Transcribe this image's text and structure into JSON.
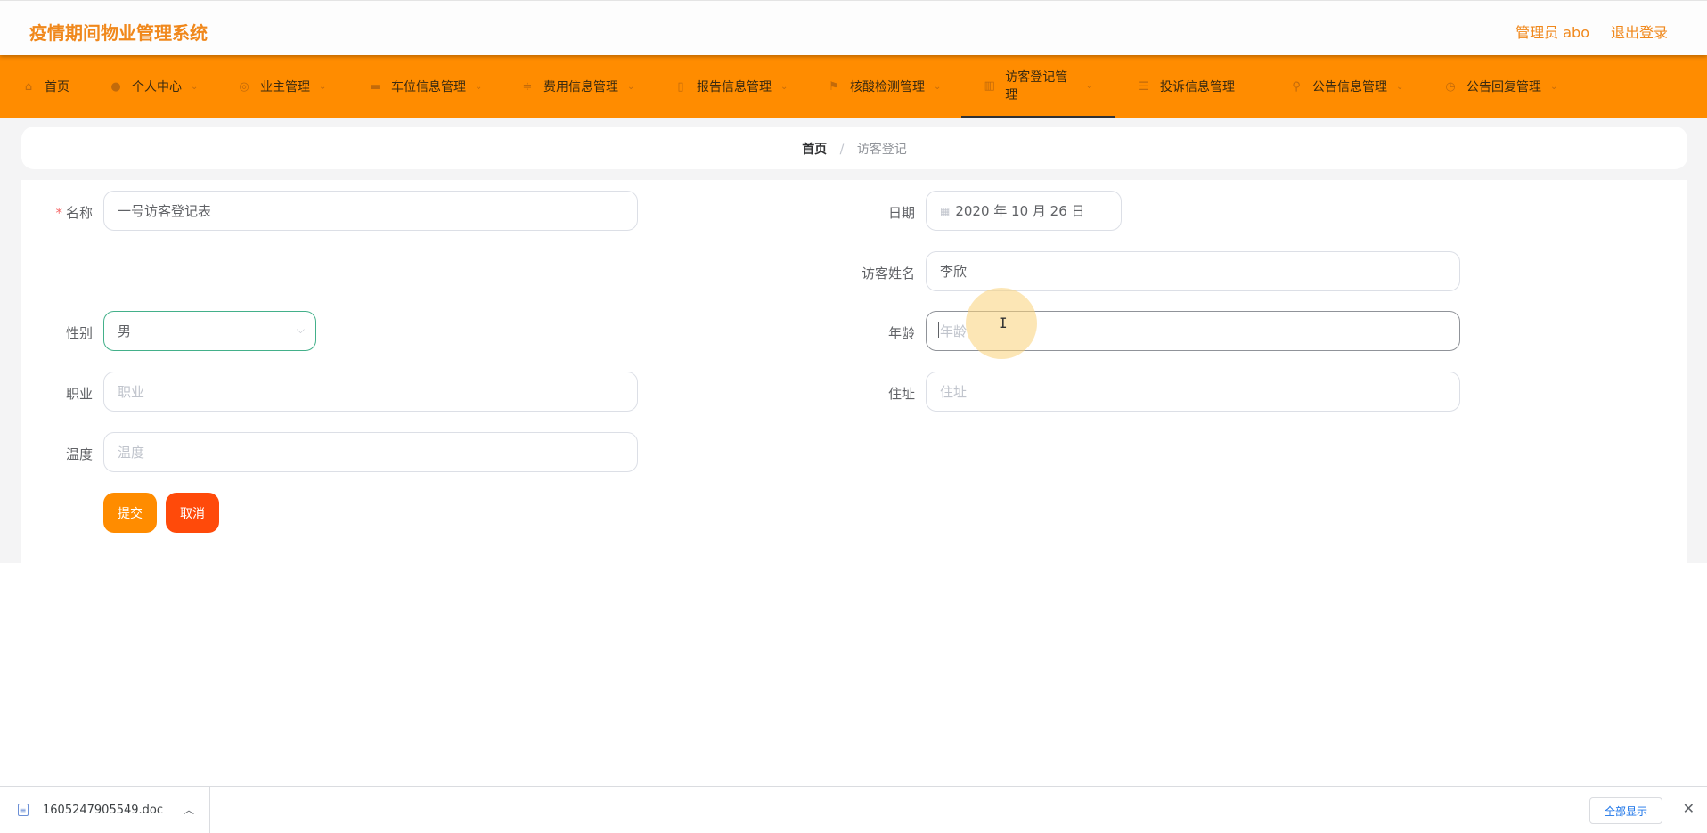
{
  "app": {
    "title": "疫情期间物业管理系统",
    "user_label": "管理员 abo",
    "logout_label": "退出登录",
    "accent_color": "#ff8c00"
  },
  "nav": {
    "items": [
      {
        "label": "首页",
        "icon": "home-icon",
        "has_menu": false
      },
      {
        "label": "个人中心",
        "icon": "user-icon",
        "has_menu": true
      },
      {
        "label": "业主管理",
        "icon": "owner-icon",
        "has_menu": true
      },
      {
        "label": "车位信息管理",
        "icon": "chat-icon",
        "has_menu": true
      },
      {
        "label": "费用信息管理",
        "icon": "sliders-icon",
        "has_menu": true
      },
      {
        "label": "报告信息管理",
        "icon": "phone-icon",
        "has_menu": true
      },
      {
        "label": "核酸检测管理",
        "icon": "flag-icon",
        "has_menu": true
      },
      {
        "label": "访客登记管理",
        "icon": "chart-icon",
        "has_menu": true,
        "active": true
      },
      {
        "label": "投诉信息管理",
        "icon": "list-icon",
        "has_menu": false
      },
      {
        "label": "公告信息管理",
        "icon": "mic-icon",
        "has_menu": true
      },
      {
        "label": "公告回复管理",
        "icon": "clock-icon",
        "has_menu": true
      }
    ]
  },
  "breadcrumb": {
    "home": "首页",
    "separator": "/",
    "current": "访客登记"
  },
  "form": {
    "name": {
      "label": "名称",
      "value": "一号访客登记表",
      "required": true
    },
    "date": {
      "label": "日期",
      "value": "2020 年 10 月 26 日"
    },
    "visitor_name": {
      "label": "访客姓名",
      "value": "李欣"
    },
    "gender": {
      "label": "性别",
      "value": "男"
    },
    "age": {
      "label": "年龄",
      "placeholder": "年龄"
    },
    "occupation": {
      "label": "职业",
      "placeholder": "职业"
    },
    "address": {
      "label": "住址",
      "placeholder": "住址"
    },
    "temperature": {
      "label": "温度",
      "placeholder": "温度"
    },
    "submit_label": "提交",
    "cancel_label": "取消"
  },
  "downloads": {
    "file_name": "1605247905549.doc",
    "show_all_label": "全部显示"
  }
}
